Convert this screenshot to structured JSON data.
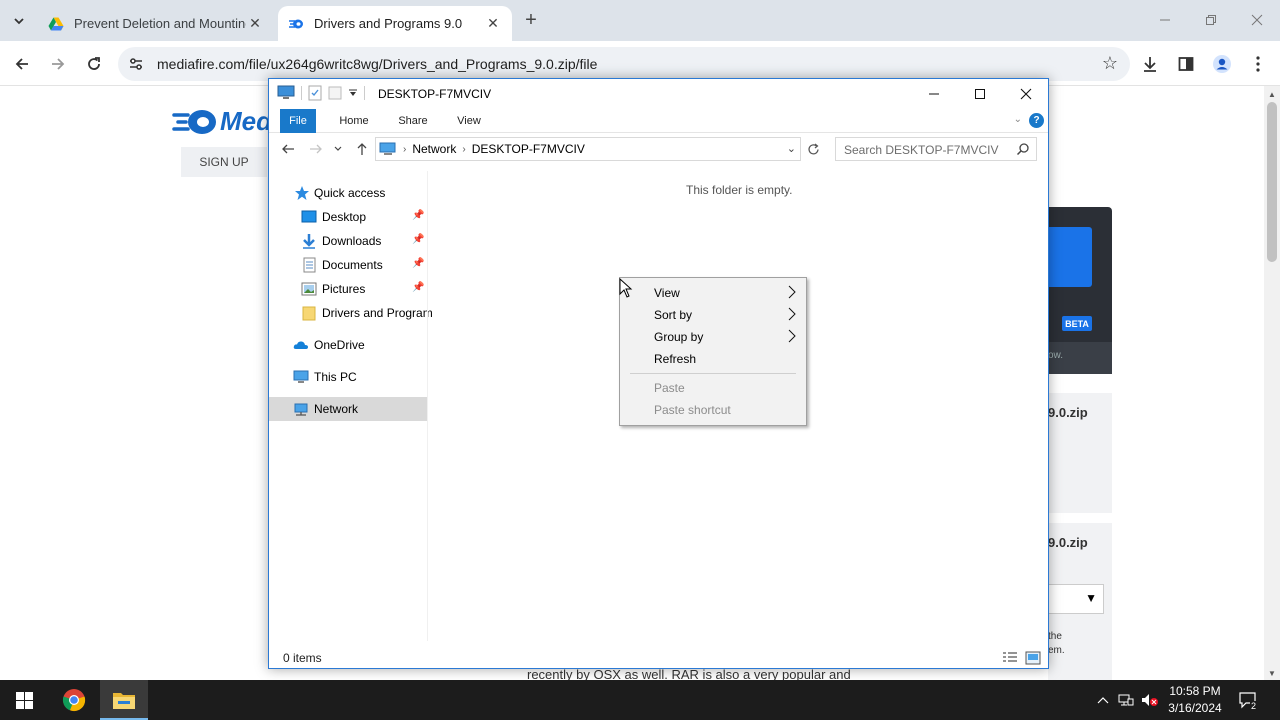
{
  "browser": {
    "tabs": [
      {
        "title": "Prevent Deletion and Mounting",
        "active": false,
        "favicon": "google-drive-icon"
      },
      {
        "title": "Drivers and Programs 9.0",
        "active": true,
        "favicon": "mediafire-icon"
      }
    ],
    "url": "mediafire.com/file/ux264g6writc8wg/Drivers_and_Programs_9.0.zip/file"
  },
  "webpage": {
    "logo_text": "Med",
    "signup_label": "SIGN UP",
    "beta_badge": "BETA",
    "dark_sub_text": "ow.",
    "card1_title": "9.0.zip",
    "card2_title": "9.0.zip",
    "side_text_1": "the",
    "side_text_2": "em.",
    "bottom_text": "recently by OSX as well. RAR is also a very popular and"
  },
  "explorer": {
    "title": "DESKTOP-F7MVCIV",
    "ribbon_tabs": [
      "File",
      "Home",
      "Share",
      "View"
    ],
    "breadcrumb": [
      "Network",
      "DESKTOP-F7MVCIV"
    ],
    "search_placeholder": "Search DESKTOP-F7MVCIV",
    "nav": {
      "quick_access": "Quick access",
      "desktop": "Desktop",
      "downloads": "Downloads",
      "documents": "Documents",
      "pictures": "Pictures",
      "drivers": "Drivers and Program",
      "onedrive": "OneDrive",
      "thispc": "This PC",
      "network": "Network"
    },
    "empty_message": "This folder is empty.",
    "status_count": "0 items"
  },
  "context_menu": {
    "items": [
      {
        "label": "View",
        "submenu": true,
        "enabled": true
      },
      {
        "label": "Sort by",
        "submenu": true,
        "enabled": true
      },
      {
        "label": "Group by",
        "submenu": true,
        "enabled": true
      },
      {
        "label": "Refresh",
        "submenu": false,
        "enabled": true
      },
      {
        "label": "Paste",
        "submenu": false,
        "enabled": false
      },
      {
        "label": "Paste shortcut",
        "submenu": false,
        "enabled": false
      }
    ]
  },
  "taskbar": {
    "time": "10:58 PM",
    "date": "3/16/2024",
    "notification_count": "2"
  },
  "colors": {
    "accent": "#1979ca",
    "taskbar": "#1c1c1c",
    "tabstrip": "#dde3ea"
  }
}
